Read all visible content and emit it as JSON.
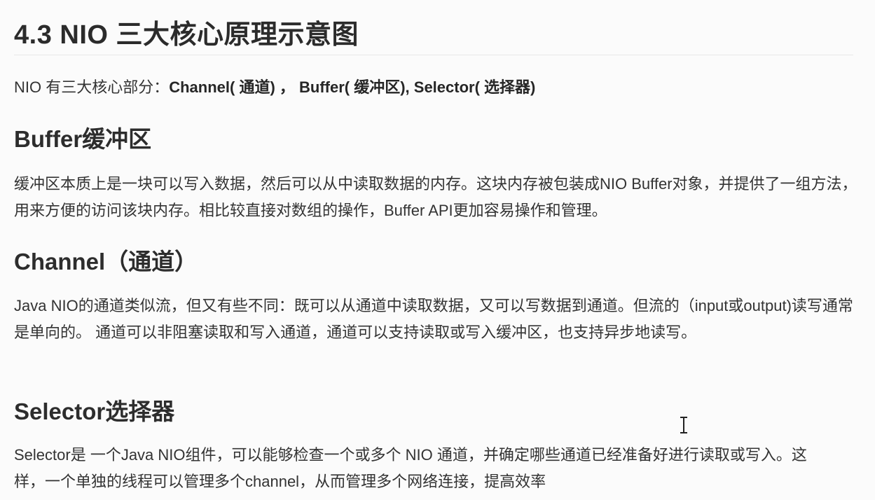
{
  "title": "4.3 NIO 三大核心原理示意图",
  "intro": {
    "prefix": "NIO 有三大核心部分：",
    "parts": "Channel( 通道) ， Buffer( 缓冲区), Selector( 选择器)"
  },
  "sections": [
    {
      "heading": "Buffer缓冲区",
      "body": "缓冲区本质上是一块可以写入数据，然后可以从中读取数据的内存。这块内存被包装成NIO Buffer对象，并提供了一组方法，用来方便的访问该块内存。相比较直接对数组的操作，Buffer API更加容易操作和管理。"
    },
    {
      "heading": "Channel（通道）",
      "body": "Java NIO的通道类似流，但又有些不同：既可以从通道中读取数据，又可以写数据到通道。但流的（input或output)读写通常是单向的。 通道可以非阻塞读取和写入通道，通道可以支持读取或写入缓冲区，也支持异步地读写。"
    },
    {
      "heading": "Selector选择器",
      "body": "Selector是 一个Java NIO组件，可以能够检查一个或多个 NIO 通道，并确定哪些通道已经准备好进行读取或写入。这样，一个单独的线程可以管理多个channel，从而管理多个网络连接，提高效率"
    }
  ],
  "cursor_icon": "text-cursor-icon"
}
